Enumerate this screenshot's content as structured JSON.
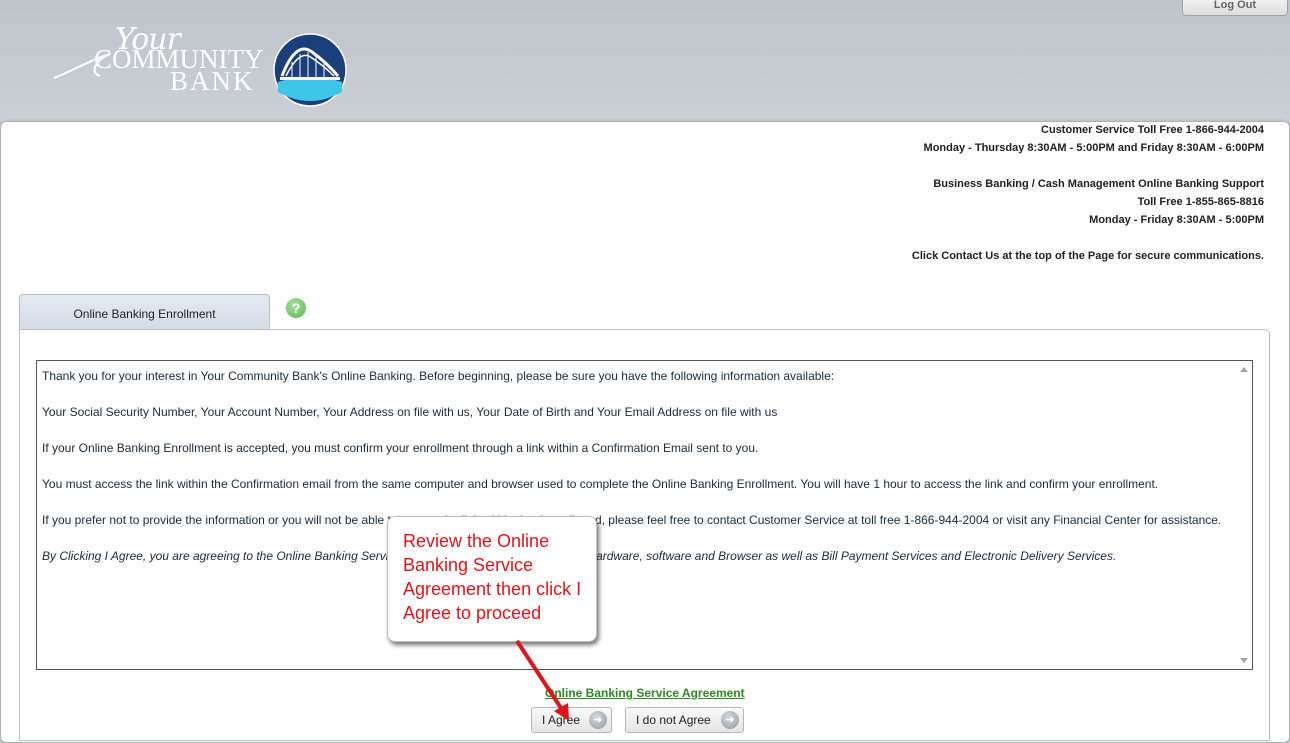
{
  "header": {
    "logout_label": "Log Out",
    "logo": {
      "line1": "Your",
      "line2": "COMMUNITY",
      "line3": "BANK"
    }
  },
  "contact": {
    "lines": [
      "Customer Service Toll Free 1-866-944-2004",
      "Monday - Thursday 8:30AM - 5:00PM and Friday 8:30AM - 6:00PM",
      "",
      "Business Banking / Cash Management Online Banking Support",
      "Toll Free 1-855-865-8816",
      "Monday - Friday 8:30AM - 5:00PM",
      "",
      "Click Contact Us at the top of the Page for secure communications."
    ]
  },
  "tab": {
    "label": "Online Banking Enrollment"
  },
  "help": {
    "icon": "help-icon",
    "glyph": "?"
  },
  "agreement": {
    "paragraphs": [
      "Thank you for your interest in Your Community Bank's Online Banking. Before beginning, please be sure you have the following information available:",
      "Your Social Security Number, Your Account Number, Your Address on file with us, Your Date of Birth and Your Email Address on file with us",
      "If your Online Banking Enrollment is accepted, you must confirm your enrollment through a link within a Confirmation Email sent to you.",
      "You must access the link within the Confirmation email from the same computer and browser used to complete the Online Banking Enrollment. You will have 1 hour to access the link and confirm your enrollment.",
      "If you prefer not to provide the information or you will not be able to access the link within the time allotted, please feel free to contact Customer Service at toll free 1-866-944-2004 or visit any Financial Center for assistance.",
      "By Clicking I Agree, you are agreeing to the Online Banking Service Agreement, including the required Hardware, software and Browser as well as Bill Payment Services and Electronic Delivery Services."
    ]
  },
  "callout": {
    "text": "Review the Online Banking Service Agreement then click I Agree to proceed",
    "color": "#e1141b"
  },
  "footer": {
    "link_label": "Online Banking Service Agreement",
    "agree_label": "I Agree",
    "disagree_label": "I do not Agree",
    "button_icon": "arrow-right-circle-icon"
  },
  "colors": {
    "accent_green": "#2d8a22",
    "callout_red": "#e1141b",
    "header_bg": "#c4c8cf"
  }
}
